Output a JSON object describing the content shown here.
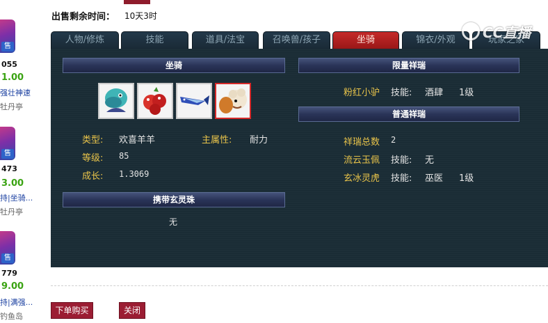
{
  "colors": {
    "panel_bg": "#1a2c35",
    "active_tab": "#b51f1f",
    "field_label": "#e8c34a",
    "button": "#9b1d33",
    "price": "#3aa312"
  },
  "header": {
    "sale_time_label": "出售剩余时间：",
    "sale_time_value": "10天3时"
  },
  "watermark": {
    "text": "CC直播",
    "icon": "cc-logo-icon"
  },
  "left_list": [
    {
      "stamp": "售",
      "id": "055",
      "price": "1.00",
      "desc": "强壮神速",
      "seller": "牡丹亭"
    },
    {
      "stamp": "售",
      "id": "473",
      "price": "3.00",
      "desc": "持|坐骑...",
      "seller": "牡丹亭"
    },
    {
      "stamp": "售",
      "id": "779",
      "price": "9.00",
      "desc": "持|满强...",
      "seller": "钓鱼岛"
    }
  ],
  "tabs": [
    {
      "label": "人物/修炼",
      "active": false
    },
    {
      "label": "技能",
      "active": false
    },
    {
      "label": "道具/法宝",
      "active": false
    },
    {
      "label": "召唤兽/孩子",
      "active": false
    },
    {
      "label": "坐骑",
      "active": true
    },
    {
      "label": "锦衣/外观",
      "active": false
    },
    {
      "label": "玩家之家",
      "active": false
    }
  ],
  "mount_section": {
    "title": "坐骑",
    "mounts": [
      {
        "icon": "teal-beast-mount-icon",
        "selected": false
      },
      {
        "icon": "red-beast-mount-icon",
        "selected": false
      },
      {
        "icon": "blue-fish-mount-icon",
        "selected": false
      },
      {
        "icon": "sheep-mount-icon",
        "selected": true
      }
    ],
    "type_label": "类型:",
    "type_value": "欢喜羊羊",
    "main_attr_label": "主属性:",
    "main_attr_value": "耐力",
    "level_label": "等级:",
    "level_value": "85",
    "growth_label": "成长:",
    "growth_value": "1.3069"
  },
  "xuanling_section": {
    "title": "携带玄灵珠",
    "value": "无"
  },
  "limited_section": {
    "title": "限量祥瑞",
    "items": [
      {
        "name": "粉红小驴",
        "skill_label": "技能:",
        "skill": "酒肆",
        "level": "1级"
      }
    ]
  },
  "normal_section": {
    "title": "普通祥瑞",
    "total_label": "祥瑞总数",
    "total_value": "2",
    "items": [
      {
        "name": "流云玉佩",
        "skill_label": "技能:",
        "skill": "无",
        "level": ""
      },
      {
        "name": "玄冰灵虎",
        "skill_label": "技能:",
        "skill": "巫医",
        "level": "1级"
      }
    ]
  },
  "buttons": {
    "buy": "下单购买",
    "close": "关闭"
  }
}
